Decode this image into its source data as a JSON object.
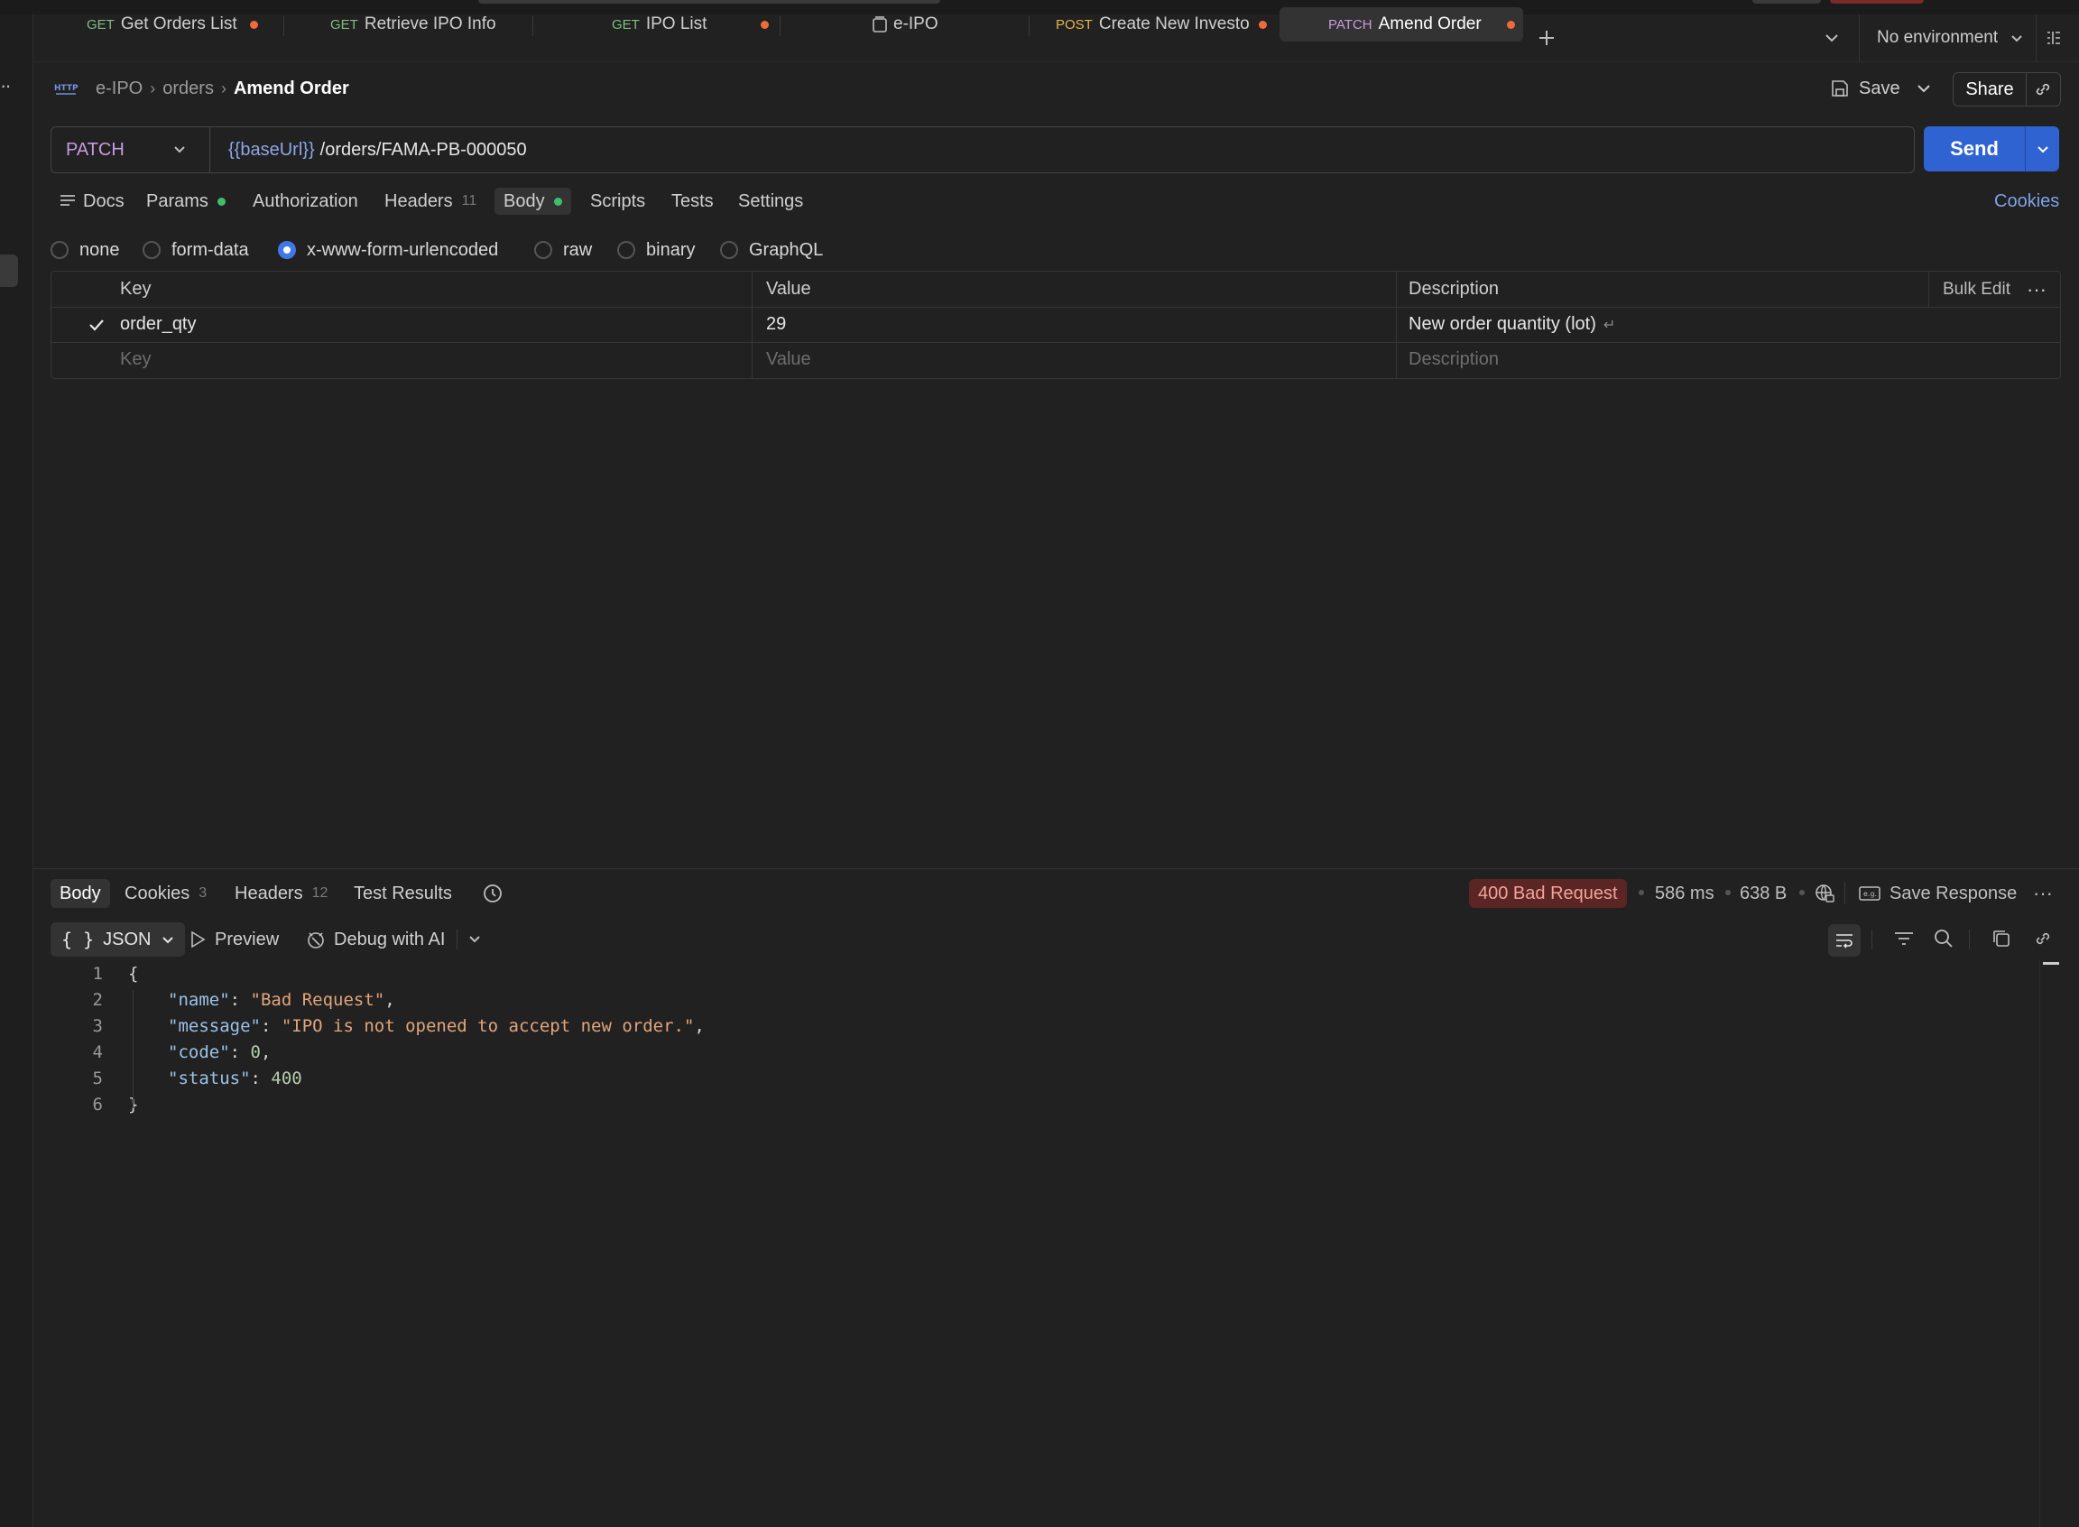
{
  "tabs": [
    {
      "method": "GET",
      "title": "Get Orders List",
      "unsaved": true
    },
    {
      "method": "GET",
      "title": "Retrieve IPO Info",
      "unsaved": false
    },
    {
      "method": "GET",
      "title": "IPO List",
      "unsaved": true
    },
    {
      "method": "",
      "title": "e-IPO",
      "unsaved": false
    },
    {
      "method": "POST",
      "title": "Create New Investo",
      "unsaved": true
    },
    {
      "method": "PATCH",
      "title": "Amend Order",
      "unsaved": true,
      "active": true
    }
  ],
  "environment": "No environment",
  "breadcrumb": {
    "collection": "e-IPO",
    "folder": "orders",
    "request": "Amend Order",
    "http_badge": "HTTP"
  },
  "actions": {
    "save": "Save",
    "share": "Share"
  },
  "request": {
    "method": "PATCH",
    "base_var": "{{baseUrl}}",
    "path": "/orders/FAMA-PB-000050",
    "send": "Send"
  },
  "request_tabs": {
    "docs": "Docs",
    "params": "Params",
    "authorization": "Authorization",
    "headers": "Headers",
    "headers_count": "11",
    "body": "Body",
    "scripts": "Scripts",
    "tests": "Tests",
    "settings": "Settings",
    "cookies": "Cookies"
  },
  "body_types": [
    "none",
    "form-data",
    "x-www-form-urlencoded",
    "raw",
    "binary",
    "GraphQL"
  ],
  "selected_body_type": "x-www-form-urlencoded",
  "kv_table": {
    "headers": {
      "key": "Key",
      "value": "Value",
      "description": "Description",
      "bulk_edit": "Bulk Edit"
    },
    "rows": [
      {
        "checked": true,
        "key": "order_qty",
        "value": "29",
        "description": "New order quantity (lot)"
      }
    ],
    "placeholders": {
      "key": "Key",
      "value": "Value",
      "description": "Description"
    }
  },
  "response_tabs": {
    "body": "Body",
    "cookies": "Cookies",
    "cookies_count": "3",
    "headers": "Headers",
    "headers_count": "12",
    "test_results": "Test Results"
  },
  "response_meta": {
    "status": "400 Bad Request",
    "time": "586 ms",
    "size": "638 B",
    "save_response": "Save Response"
  },
  "response_toolbar": {
    "format": "JSON",
    "preview": "Preview",
    "debug": "Debug with AI"
  },
  "response_body": {
    "line_numbers": [
      "1",
      "2",
      "3",
      "4",
      "5",
      "6"
    ],
    "open": "{",
    "close": "}",
    "fields": [
      {
        "key": "\"name\"",
        "value": "\"Bad Request\"",
        "type": "string",
        "comma": ","
      },
      {
        "key": "\"message\"",
        "value": "\"IPO is not opened to accept new order.\"",
        "type": "string",
        "comma": ","
      },
      {
        "key": "\"code\"",
        "value": "0",
        "type": "number",
        "comma": ","
      },
      {
        "key": "\"status\"",
        "value": "400",
        "type": "number",
        "comma": ""
      }
    ]
  },
  "colors": {
    "accent": "#2f63d2",
    "get": "#7fbf82",
    "post": "#e9b44c",
    "patch": "#c79adf",
    "unsaved_dot": "#f06a3a",
    "status_bg": "#5a2523",
    "status_fg": "#f2a39a"
  }
}
